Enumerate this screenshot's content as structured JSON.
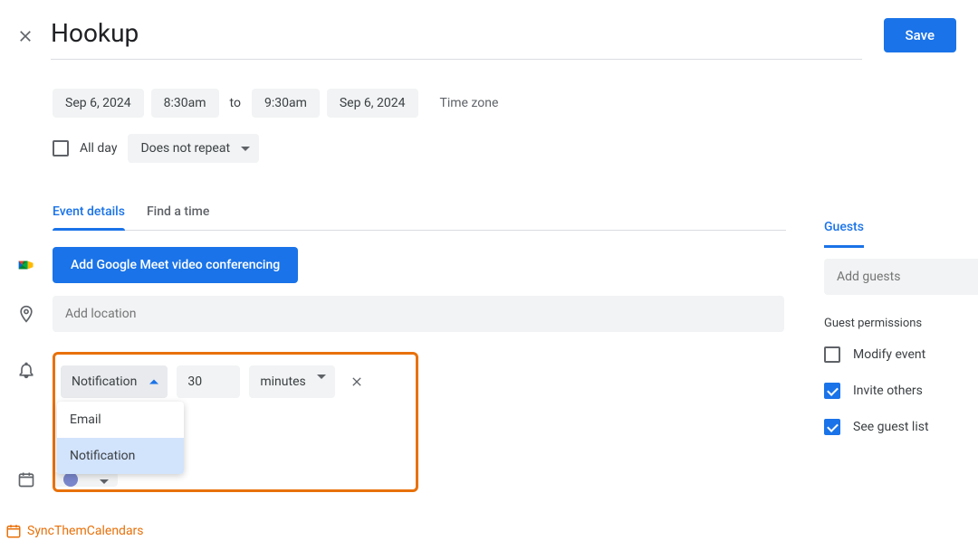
{
  "header": {
    "title": "Hookup",
    "save_label": "Save"
  },
  "datetime": {
    "start_date": "Sep 6, 2024",
    "start_time": "8:30am",
    "to": "to",
    "end_time": "9:30am",
    "end_date": "Sep 6, 2024",
    "timezone": "Time zone"
  },
  "options": {
    "all_day_label": "All day",
    "repeat_label": "Does not repeat"
  },
  "tabs": {
    "event_details": "Event details",
    "find_time": "Find a time"
  },
  "meet": {
    "button": "Add Google Meet video conferencing"
  },
  "location": {
    "placeholder": "Add location"
  },
  "notification": {
    "type_label": "Notification",
    "value": "30",
    "unit": "minutes",
    "options": {
      "email": "Email",
      "notification": "Notification"
    }
  },
  "guests": {
    "tab": "Guests",
    "placeholder": "Add guests",
    "permissions_title": "Guest permissions",
    "modify": "Modify event",
    "invite": "Invite others",
    "see_list": "See guest list"
  },
  "watermark": "SyncThemCalendars"
}
